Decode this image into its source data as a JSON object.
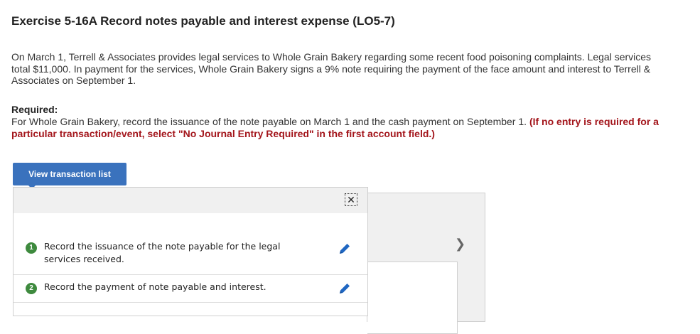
{
  "exercise": {
    "title": "Exercise 5-16A Record notes payable and interest expense (LO5-7)",
    "paragraph": "On March 1, Terrell & Associates provides legal services to Whole Grain Bakery regarding some recent food poisoning complaints. Legal services total $11,000. In payment for the services, Whole Grain Bakery signs a 9% note requiring the payment of the face amount and interest to Terrell & Associates on September 1.",
    "required_label": "Required:",
    "required_text": "For Whole Grain Bakery, record the issuance of the note payable on March 1 and the cash payment on September 1.",
    "required_note": "(If no entry is required for a particular transaction/event, select \"No Journal Entry Required\" in the first account field.)"
  },
  "transaction_button": {
    "label": "View transaction list"
  },
  "transactions": [
    {
      "number": "1",
      "text": "Record the issuance of the note payable for the legal services received."
    },
    {
      "number": "2",
      "text": "Record the payment of note payable and interest."
    }
  ],
  "icons": {
    "close": "close-icon",
    "edit": "pencil-icon",
    "next": "chevron-right-icon"
  },
  "colors": {
    "accent_blue": "#3a72bd",
    "step_green": "#3e8a3e",
    "note_red": "#a3151b",
    "pencil_blue": "#1f66c1"
  }
}
